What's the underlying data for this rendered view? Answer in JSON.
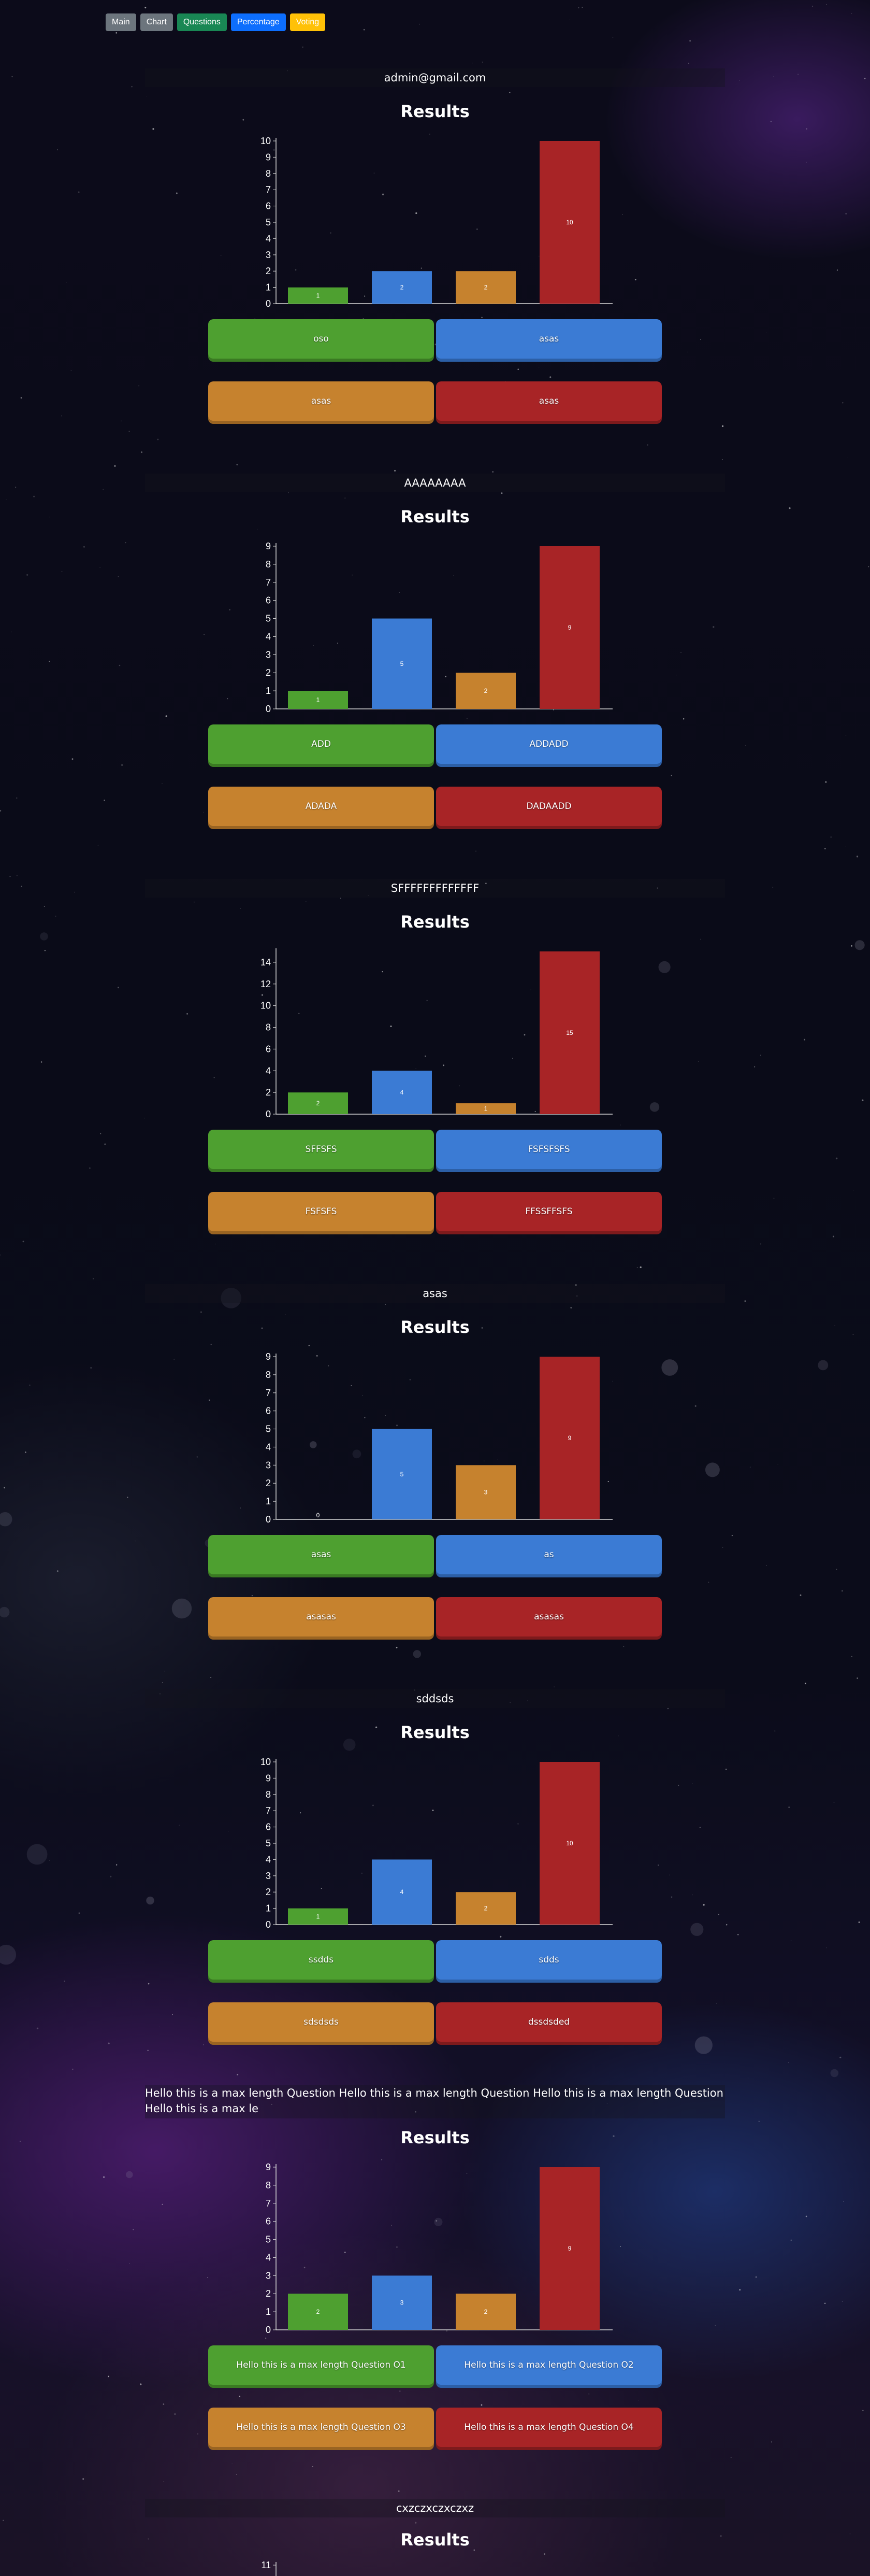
{
  "nav": {
    "main": "Main",
    "chart": "Chart",
    "questions": "Questions",
    "percentage": "Percentage",
    "voting": "Voting"
  },
  "colors": {
    "answer_a": "#4ea030",
    "answer_b": "#3b7bd4",
    "answer_c": "#c6822e",
    "answer_d": "#a82426"
  },
  "results_label": "Results",
  "sections": [
    {
      "question": "admin@gmail.com",
      "answers": [
        "oso",
        "asas",
        "asas",
        "asas"
      ],
      "chart_data": {
        "type": "bar",
        "values": [
          1,
          2,
          2,
          10
        ],
        "y_ticks": [
          0,
          1,
          2,
          3,
          4,
          5,
          6,
          7,
          8,
          9,
          10
        ],
        "ylim": [
          0,
          10
        ]
      }
    },
    {
      "question": "AAAAAAAA",
      "answers": [
        "ADD",
        "ADDADD",
        "ADADA",
        "DADAADD"
      ],
      "chart_data": {
        "type": "bar",
        "values": [
          1,
          5,
          2,
          9
        ],
        "y_ticks": [
          0,
          1,
          2,
          3,
          4,
          5,
          6,
          7,
          8,
          9
        ],
        "ylim": [
          0,
          9
        ]
      }
    },
    {
      "question": "SFFFFFFFFFFFFF",
      "answers": [
        "SFFSFS",
        "FSFSFSFS",
        "FSFSFS",
        "FFSSFFSFS"
      ],
      "chart_data": {
        "type": "bar",
        "values": [
          2,
          4,
          1,
          15
        ],
        "y_ticks": [
          0,
          2,
          4,
          6,
          8,
          10,
          12,
          14
        ],
        "ylim": [
          0,
          15
        ]
      }
    },
    {
      "question": "asas",
      "answers": [
        "asas",
        "as",
        "asasas",
        "asasas"
      ],
      "chart_data": {
        "type": "bar",
        "values": [
          0,
          5,
          3,
          9
        ],
        "y_ticks": [
          0,
          1,
          2,
          3,
          4,
          5,
          6,
          7,
          8,
          9
        ],
        "ylim": [
          0,
          9
        ]
      }
    },
    {
      "question": "sddsds",
      "answers": [
        "ssdds",
        "sdds",
        "sdsdsds",
        "dssdsded"
      ],
      "chart_data": {
        "type": "bar",
        "values": [
          1,
          4,
          2,
          10
        ],
        "y_ticks": [
          0,
          1,
          2,
          3,
          4,
          5,
          6,
          7,
          8,
          9,
          10
        ],
        "ylim": [
          0,
          10
        ]
      }
    },
    {
      "question": "Hello this is a max length Question Hello this is a max length Question Hello this is a max length Question Hello this is a max le",
      "answers": [
        "Hello this is a max length Question O1",
        "Hello this is a max length Question O2",
        "Hello this is a max length Question O3",
        "Hello this is a max length Question O4"
      ],
      "chart_data": {
        "type": "bar",
        "values": [
          2,
          3,
          2,
          9
        ],
        "y_ticks": [
          0,
          1,
          2,
          3,
          4,
          5,
          6,
          7,
          8,
          9
        ],
        "ylim": [
          0,
          9
        ]
      }
    },
    {
      "question": "cxzczxczxczxz",
      "answers": [],
      "chart_data": {
        "type": "bar",
        "values": [],
        "y_ticks": [
          11
        ],
        "ylim": [
          0,
          11
        ]
      }
    }
  ]
}
